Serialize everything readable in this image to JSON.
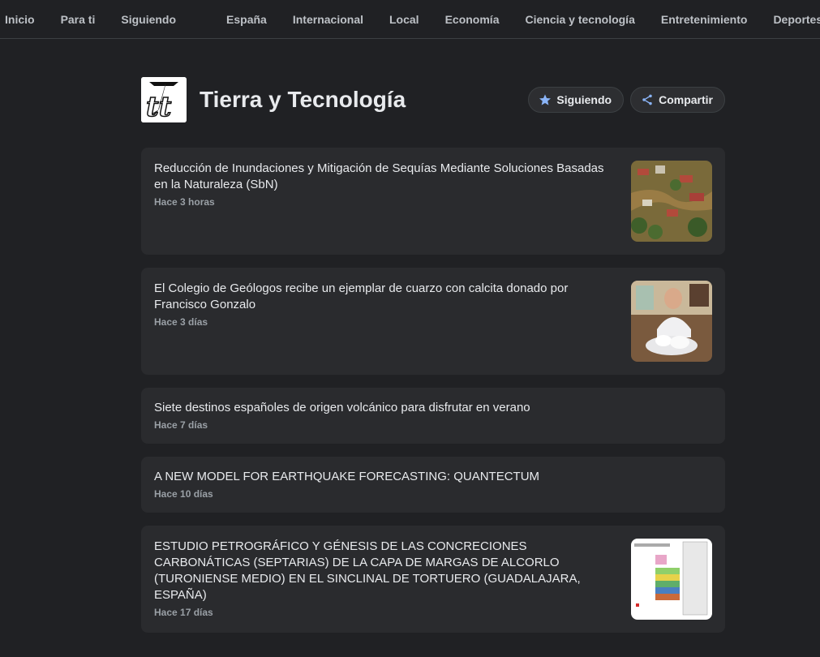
{
  "nav": {
    "items": [
      "Inicio",
      "Para ti",
      "Siguiendo"
    ],
    "sections": [
      "España",
      "Internacional",
      "Local",
      "Economía",
      "Ciencia y tecnología",
      "Entretenimiento",
      "Deportes"
    ]
  },
  "header": {
    "title": "Tierra y Tecnología",
    "follow_label": "Siguiendo",
    "share_label": "Compartir"
  },
  "articles": [
    {
      "headline": "Reducción de Inundaciones y Mitigación de Sequías Mediante Soluciones Basadas en la Naturaleza (SbN)",
      "time": "Hace 3 horas"
    },
    {
      "headline": "El Colegio de Geólogos recibe un ejemplar de cuarzo con calcita donado por Francisco Gonzalo",
      "time": "Hace 3 días"
    },
    {
      "headline": "Siete destinos españoles de origen volcánico para disfrutar en verano",
      "time": "Hace 7 días"
    },
    {
      "headline": "A NEW MODEL FOR EARTHQUAKE FORECASTING: QUANTECTUM",
      "time": "Hace 10 días"
    },
    {
      "headline": "ESTUDIO PETROGRÁFICO Y GÉNESIS DE LAS CONCRECIONES CARBONÁTICAS (SEPTARIAS) DE LA CAPA DE MARGAS DE ALCORLO (TURONIENSE MEDIO) EN EL SINCLINAL DE TORTUERO (GUADALAJARA, ESPAÑA)",
      "time": "Hace 17 días"
    }
  ],
  "colors": {
    "background": "#202124",
    "card": "#2a2b2e",
    "accent": "#8ab4f8"
  }
}
